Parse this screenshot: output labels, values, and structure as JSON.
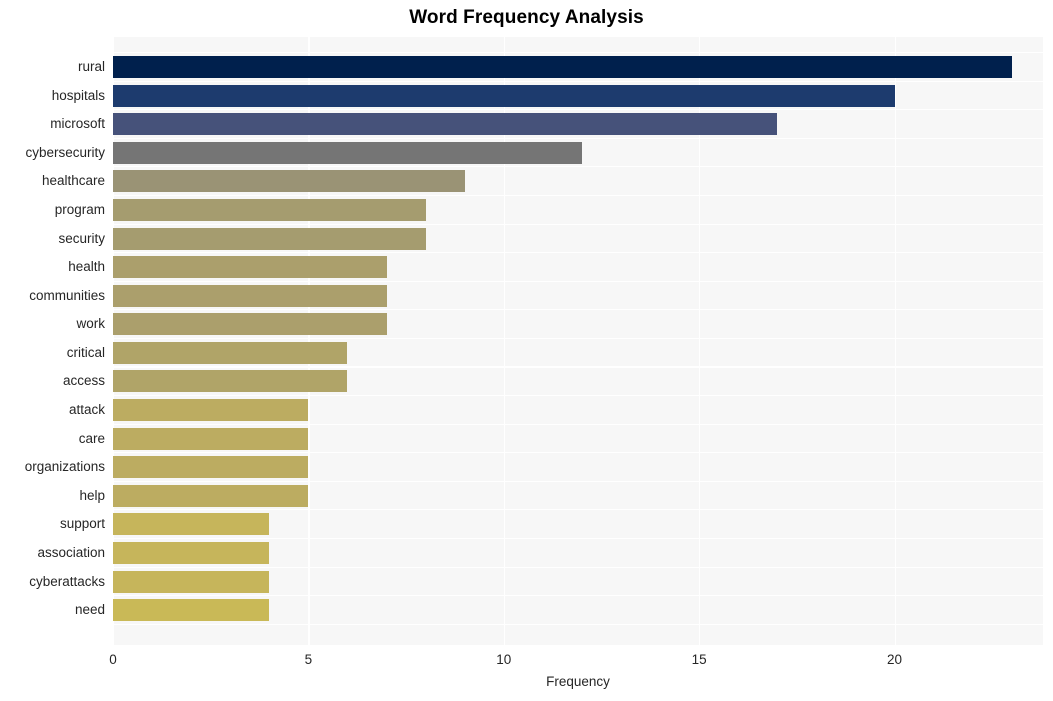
{
  "chart_data": {
    "type": "bar",
    "orientation": "horizontal",
    "title": "Word Frequency Analysis",
    "xlabel": "Frequency",
    "ylabel": "",
    "xlim": [
      0,
      23.8
    ],
    "xticks": [
      0,
      5,
      10,
      15,
      20
    ],
    "xticklabels": [
      "0",
      "5",
      "10",
      "15",
      "20"
    ],
    "grid": true,
    "legend": null,
    "categories": [
      "rural",
      "hospitals",
      "microsoft",
      "cybersecurity",
      "healthcare",
      "program",
      "security",
      "health",
      "communities",
      "work",
      "critical",
      "access",
      "attack",
      "care",
      "organizations",
      "help",
      "support",
      "association",
      "cyberattacks",
      "need"
    ],
    "values": [
      23,
      20,
      17,
      12,
      9,
      8,
      8,
      7,
      7,
      7,
      6,
      6,
      5,
      5,
      5,
      5,
      4,
      4,
      4,
      4
    ],
    "colors": [
      "#00204d",
      "#1d3b6e",
      "#46527a",
      "#757575",
      "#9a9375",
      "#a59c6f",
      "#a59c6f",
      "#ab9f6c",
      "#ab9f6c",
      "#ab9f6c",
      "#b0a468",
      "#b0a468",
      "#bcac61",
      "#bcac61",
      "#bcac61",
      "#bcac61",
      "#c6b55b",
      "#c6b55b",
      "#c6b55b",
      "#c9b957"
    ]
  },
  "figure": {
    "background": "#ffffff",
    "plot_background": "#f7f7f7",
    "gridline_color": "#ffffff",
    "tick_text_color": "#262626",
    "title_color": "#000000"
  }
}
